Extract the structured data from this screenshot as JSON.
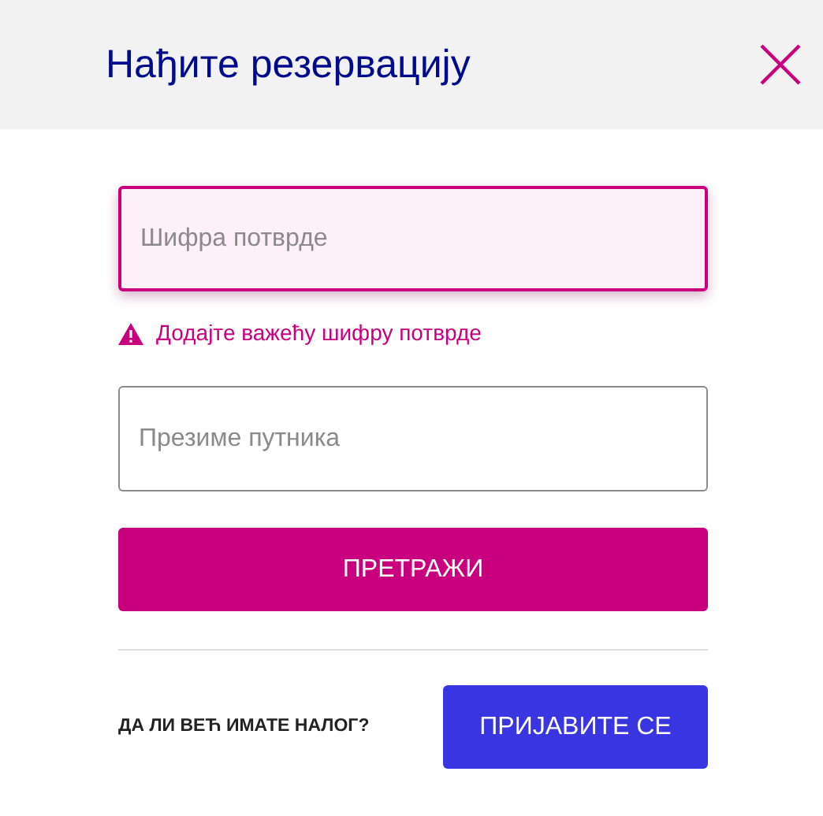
{
  "dialog": {
    "title": "Нађите резервацију",
    "closable": true
  },
  "fields": [
    {
      "placeholder": "Шифра потврде",
      "invalid": true,
      "error": "Додајте важећу шифру потврде"
    },
    {
      "placeholder": "Презиме путника",
      "invalid": false
    }
  ],
  "search_button": "ПРЕТРАЖИ",
  "login_prompt": "ДА ЛИ ВЕЋ ИМАТЕ НАЛОГ?",
  "login_button": "ПРИЈАВИТЕ СЕ"
}
